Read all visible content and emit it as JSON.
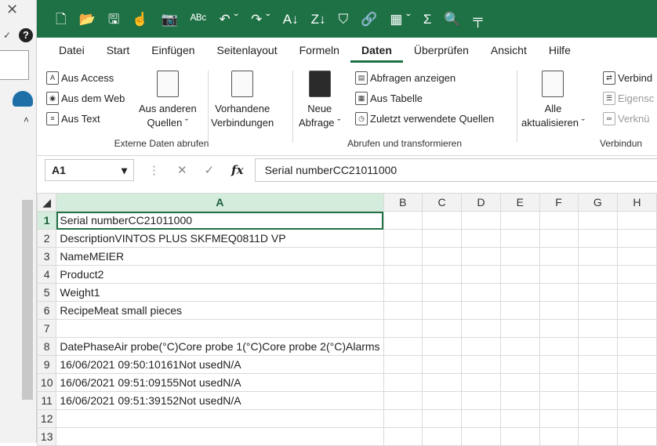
{
  "quick_access": {
    "icons": [
      "new-icon",
      "open-icon",
      "save-icon",
      "touch-icon",
      "camera-icon",
      "spelling-icon",
      "undo-icon",
      "redo-icon",
      "sort-asc-icon",
      "sort-desc-icon",
      "filter-icon",
      "share-icon",
      "table-icon",
      "sum-icon",
      "preview-icon",
      "more-icon"
    ],
    "glyphs": [
      "🗋",
      "📂",
      "🖫",
      "☝",
      "📷",
      "ᴬᴮᶜ",
      "↶ ˇ",
      "↷ ˇ",
      "A↓",
      "Z↓",
      "⛉",
      "🔗",
      "▦ ˇ",
      "Σ",
      "🔍",
      "╤"
    ]
  },
  "menu": {
    "tabs": [
      "Datei",
      "Start",
      "Einfügen",
      "Seitenlayout",
      "Formeln",
      "Daten",
      "Überprüfen",
      "Ansicht",
      "Hilfe"
    ],
    "active_tab": "Daten"
  },
  "ribbon": {
    "external": {
      "access": "Aus Access",
      "web": "Aus dem Web",
      "text": "Aus Text",
      "other_line1": "Aus anderen",
      "other_line2": "Quellen ˇ",
      "existing_line1": "Vorhandene",
      "existing_line2": "Verbindungen",
      "group_label": "Externe Daten abrufen"
    },
    "transform": {
      "new_line1": "Neue",
      "new_line2": "Abfrage ˇ",
      "show_queries": "Abfragen anzeigen",
      "from_table": "Aus Tabelle",
      "recent_sources": "Zuletzt verwendete Quellen",
      "group_label": "Abrufen und transformieren"
    },
    "connections": {
      "refresh_line1": "Alle",
      "refresh_line2": "aktualisieren ˇ",
      "connections": "Verbind",
      "properties": "Eigensc",
      "edit_links": "Verknü",
      "group_label": "Verbindun"
    }
  },
  "formula_bar": {
    "name_box": "A1",
    "cancel": "✕",
    "enter": "✓",
    "fx": "fx",
    "content": "Serial numberCC21011000"
  },
  "sheet": {
    "columns": [
      "A",
      "B",
      "C",
      "D",
      "E",
      "F",
      "G",
      "H"
    ],
    "rows": [
      {
        "n": "1",
        "text": "Serial numberCC21011000"
      },
      {
        "n": "2",
        "text": "DescriptionVINTOS PLUS SKFMEQ0811D VP"
      },
      {
        "n": "3",
        "text": "NameMEIER"
      },
      {
        "n": "4",
        "text": "Product2"
      },
      {
        "n": "5",
        "text": "Weight1"
      },
      {
        "n": "6",
        "text": "RecipeMeat small pieces"
      },
      {
        "n": "7",
        "text": ""
      },
      {
        "n": "8",
        "text": "DatePhaseAir probe(°C)Core probe 1(°C)Core probe 2(°C)Alarms"
      },
      {
        "n": "9",
        "text": "16/06/2021 09:50:10161Not usedN/A"
      },
      {
        "n": "10",
        "text": "16/06/2021 09:51:09155Not usedN/A"
      },
      {
        "n": "11",
        "text": "16/06/2021 09:51:39152Not usedN/A"
      },
      {
        "n": "12",
        "text": ""
      },
      {
        "n": "13",
        "text": ""
      }
    ]
  },
  "colors": {
    "brand": "#1e7145",
    "selected_header": "#d3ecdc"
  }
}
